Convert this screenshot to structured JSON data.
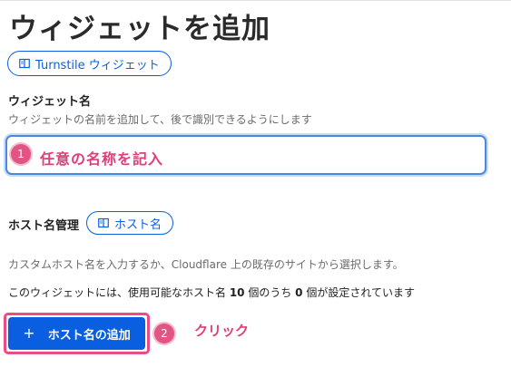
{
  "page": {
    "title": "ウィジェットを追加"
  },
  "docs_links": {
    "turnstile_label": "Turnstile ウィジェット",
    "hostname_label": "ホスト名"
  },
  "widget_name": {
    "label": "ウィジェット名",
    "help": "ウィジェットの名前を追加して、後で識別できるようにします",
    "value": "",
    "placeholder": ""
  },
  "hostname_management": {
    "title": "ホスト名管理",
    "description": "カスタムホスト名を入力するか、Cloudflare 上の既存のサイトから選択します。",
    "count_prefix": "このウィジェットには、使用可能なホスト名 ",
    "count_total": "10",
    "count_middle": " 個のうち ",
    "count_used": "0",
    "count_suffix": " 個が設定されています",
    "add_button_label": "ホスト名の追加"
  },
  "annotations": {
    "step1_number": "1",
    "step1_text": "任意の名称を記入",
    "step2_number": "2",
    "step2_text": "クリック"
  },
  "colors": {
    "accent": "#0a5fe0",
    "annotation": "#e03d79",
    "highlight_border": "#ea4d86"
  },
  "icons": {
    "docs_link": "book-icon",
    "add": "plus-icon"
  }
}
